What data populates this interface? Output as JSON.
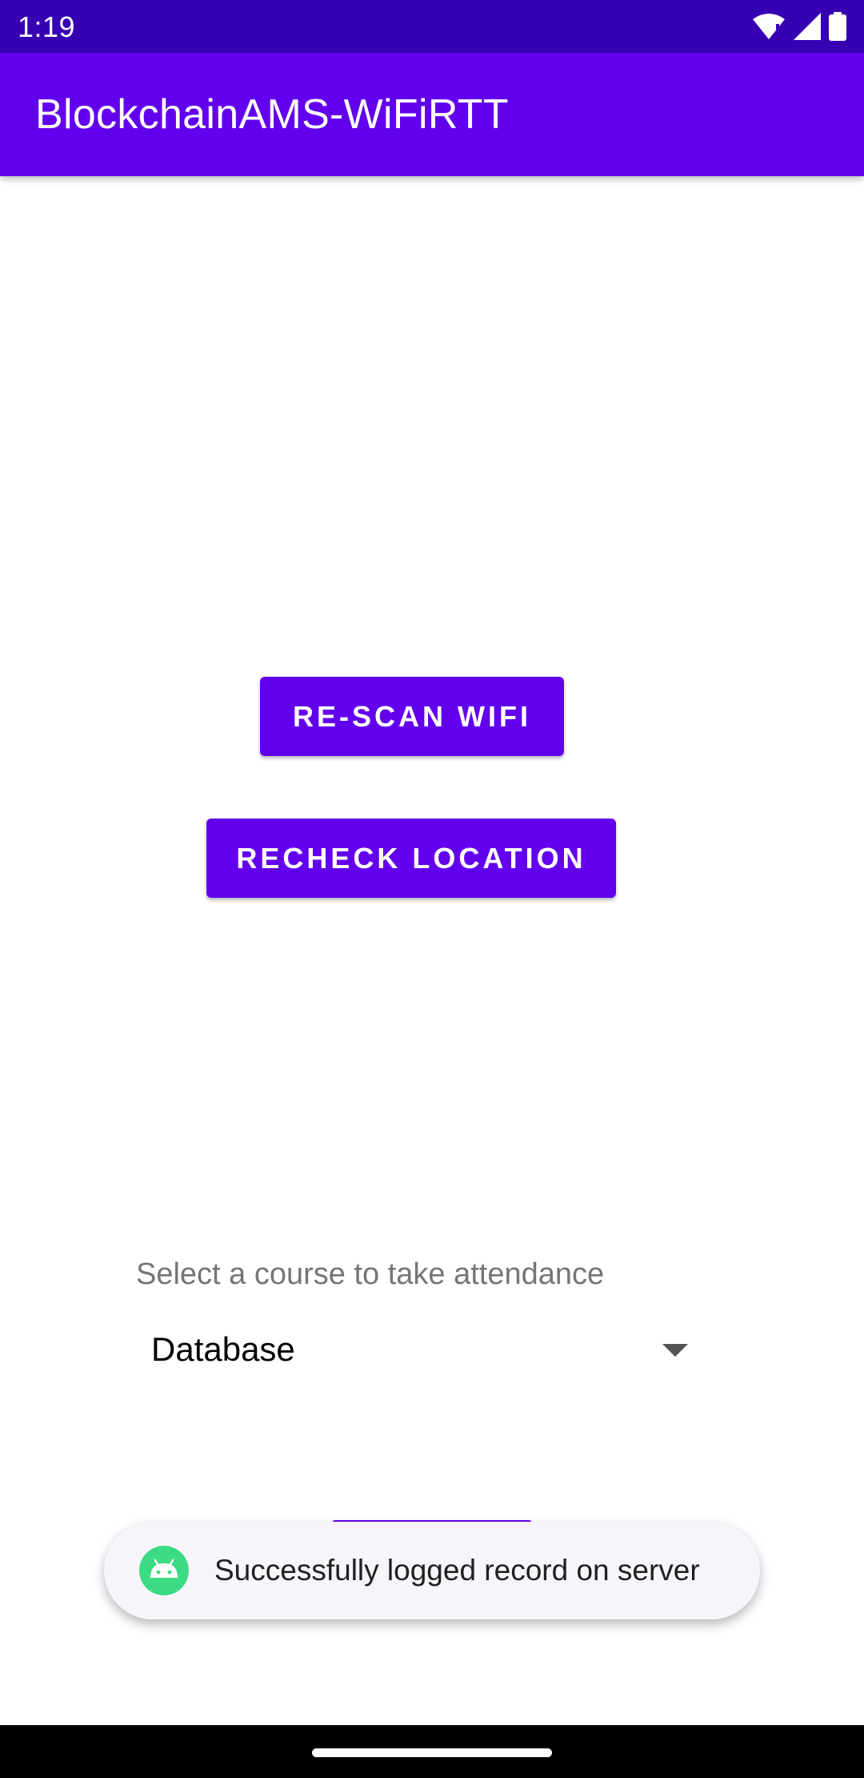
{
  "status_bar": {
    "time": "1:19",
    "icons": [
      "wifi-icon",
      "signal-icon",
      "battery-icon"
    ]
  },
  "app_bar": {
    "title": "BlockchainAMS-WiFiRTT"
  },
  "buttons": {
    "rescan_label": "RE-SCAN WIFI",
    "recheck_label": "RECHECK LOCATION"
  },
  "course": {
    "prompt": "Select a course to take attendance",
    "selected": "Database"
  },
  "toast": {
    "message": "Successfully logged record on server",
    "icon": "android-icon"
  },
  "colors": {
    "primary": "#6200ee",
    "primary_dark": "#3700b3",
    "toast_icon_bg": "#3ddc84"
  }
}
